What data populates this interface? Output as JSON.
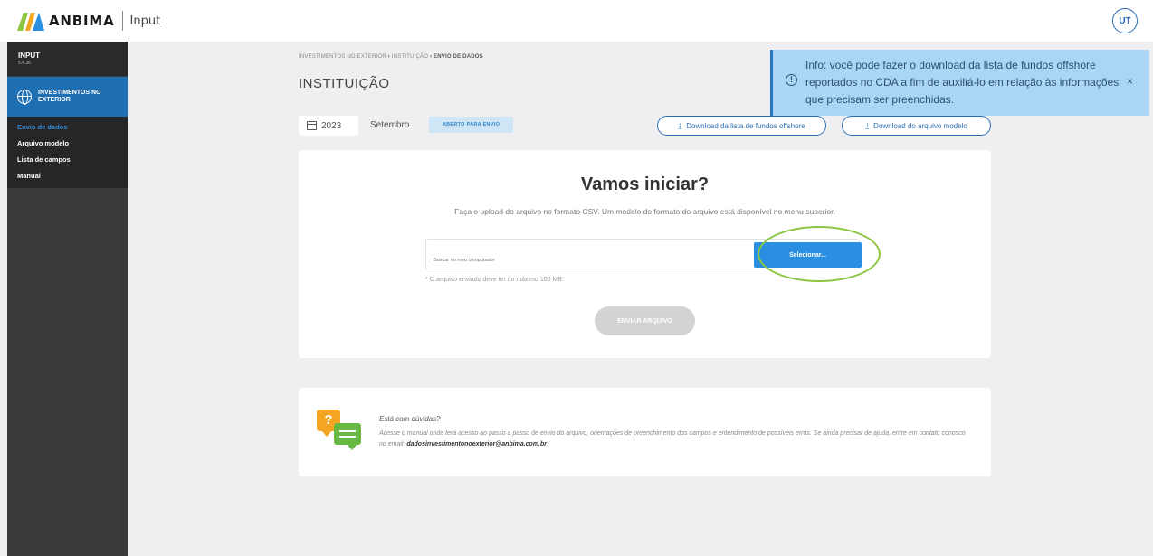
{
  "header": {
    "logo_text": "ANBIMA",
    "app_name": "Input",
    "avatar_initials": "UT"
  },
  "sidebar": {
    "title": "INPUT",
    "version": "5.4.36",
    "section_label": "INVESTIMENTOS NO EXTERIOR",
    "items": [
      {
        "label": "Envio de dados",
        "active": true
      },
      {
        "label": "Arquivo modelo",
        "active": false
      },
      {
        "label": "Lista de campos",
        "active": false
      },
      {
        "label": "Manual",
        "active": false
      }
    ]
  },
  "breadcrumb": {
    "part1": "INVESTIMENTOS NO EXTERIOR",
    "part2": "INSTITUIÇÃO",
    "part3": "ENVIO DE DADOS",
    "separator": "›"
  },
  "page_title": "INSTITUIÇÃO",
  "period": {
    "year": "2023",
    "month": "Setembro",
    "status": "ABERTO PARA ENVIO"
  },
  "downloads": {
    "offshore_list": "Download da lista de fundos offshore",
    "model_file": "Download do arquivo modelo"
  },
  "toast": {
    "text": "Info: você pode fazer o download da lista de fundos offshore reportados no CDA a fim de auxiliá-lo em relação às informações que precisam ser preenchidas.",
    "close": "×"
  },
  "upload": {
    "title": "Vamos iniciar?",
    "description": "Faça o upload do arquivo no formato CSV. Um modelo do formato do arquivo está disponível no menu superior.",
    "placeholder": "Buscar no meu computador",
    "select_label": "Selecionar...",
    "hint": "* O arquivo enviado deve ter no máximo 100 MB.",
    "send_label": "ENVIAR ARQUIVO"
  },
  "help": {
    "title": "Está com dúvidas?",
    "body_prefix": "Acesse o manual onde terá acesso ao passo a passo de envio do arquivo, orientações de preenchimento dos campos e entendimento de possíveis erros. Se ainda precisar de ajuda, entre em contato conosco no email: ",
    "email": "dadosinvestimentonoexterior@anbima.com.br",
    "body_suffix": "."
  },
  "colors": {
    "primary": "#2a8fe0",
    "brand_blue": "#1f6fb5",
    "toast_bg": "#a9d6f5",
    "highlight": "#8cc63f"
  }
}
